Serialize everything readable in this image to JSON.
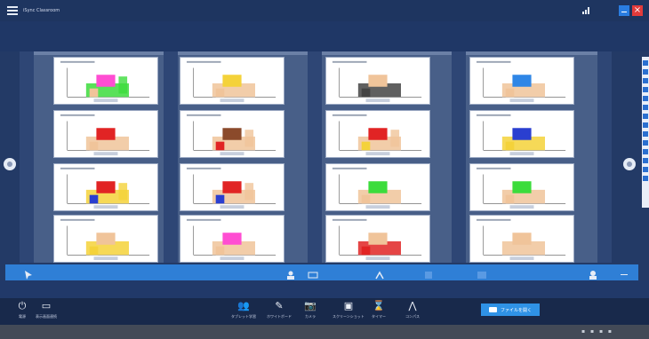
{
  "app": {
    "title": "iSync Classroom"
  },
  "window": {
    "minimize_label": "",
    "close_label": "×"
  },
  "colors": {
    "titlebar": "#1e3560",
    "board_bg": "#485f88",
    "toolbar_blue": "#2f7fd6",
    "bottombar": "#18294b",
    "accent_button": "#2f92e6",
    "close_red": "#e23b3b"
  },
  "thumbnails": [
    {
      "id": "1",
      "fills": [
        "#ff4dd2",
        "#f0c49a",
        "#3cdc3c"
      ]
    },
    {
      "id": "2",
      "fills": [
        "#f4d23a",
        "#f0c49a"
      ]
    },
    {
      "id": "3",
      "fills": [
        "#f0c49a",
        "#444444"
      ]
    },
    {
      "id": "4",
      "fills": [
        "#2f86e6",
        "#f0c49a"
      ]
    },
    {
      "id": "5",
      "fills": [
        "#e12424",
        "#f0c49a"
      ]
    },
    {
      "id": "6",
      "fills": [
        "#8b4a2b",
        "#e12424",
        "#f0c49a"
      ]
    },
    {
      "id": "7",
      "fills": [
        "#e12424",
        "#f4d23a",
        "#f0c49a"
      ]
    },
    {
      "id": "8",
      "fills": [
        "#2a3fd0",
        "#f4d23a"
      ]
    },
    {
      "id": "9",
      "fills": [
        "#e12424",
        "#2a3fd0",
        "#f4d23a"
      ]
    },
    {
      "id": "10",
      "fills": [
        "#e12424",
        "#2a3fd0",
        "#f0c49a"
      ]
    },
    {
      "id": "11",
      "fills": [
        "#3cdc3c",
        "#f0c49a"
      ]
    },
    {
      "id": "12",
      "fills": [
        "#3cdc3c",
        "#f0c49a"
      ]
    },
    {
      "id": "13",
      "fills": [
        "#f0c49a",
        "#f4d23a"
      ]
    },
    {
      "id": "14",
      "fills": [
        "#ff4dd2",
        "#f0c49a"
      ]
    },
    {
      "id": "15",
      "fills": [
        "#f0c49a",
        "#e12424"
      ]
    },
    {
      "id": "16",
      "fills": [
        "#f0c49a"
      ]
    }
  ],
  "bottombar": {
    "power_label": "電源",
    "screen_label": "表示画面連続",
    "tablet_label": "タブレット学習",
    "whiteboard_label": "ホワイトボード",
    "camera_label": "カメラ",
    "screenshot_label": "スクリーンショット",
    "timer_label": "タイマー",
    "compass_label": "コンパス",
    "open_file_label": "ファイルを開く"
  },
  "icons": {
    "power": "⏻",
    "screen": "▭",
    "tablet": "👥",
    "whiteboard": "✎",
    "camera": "📷",
    "screenshot": "▣",
    "timer": "⌛",
    "compass": "⋀"
  }
}
